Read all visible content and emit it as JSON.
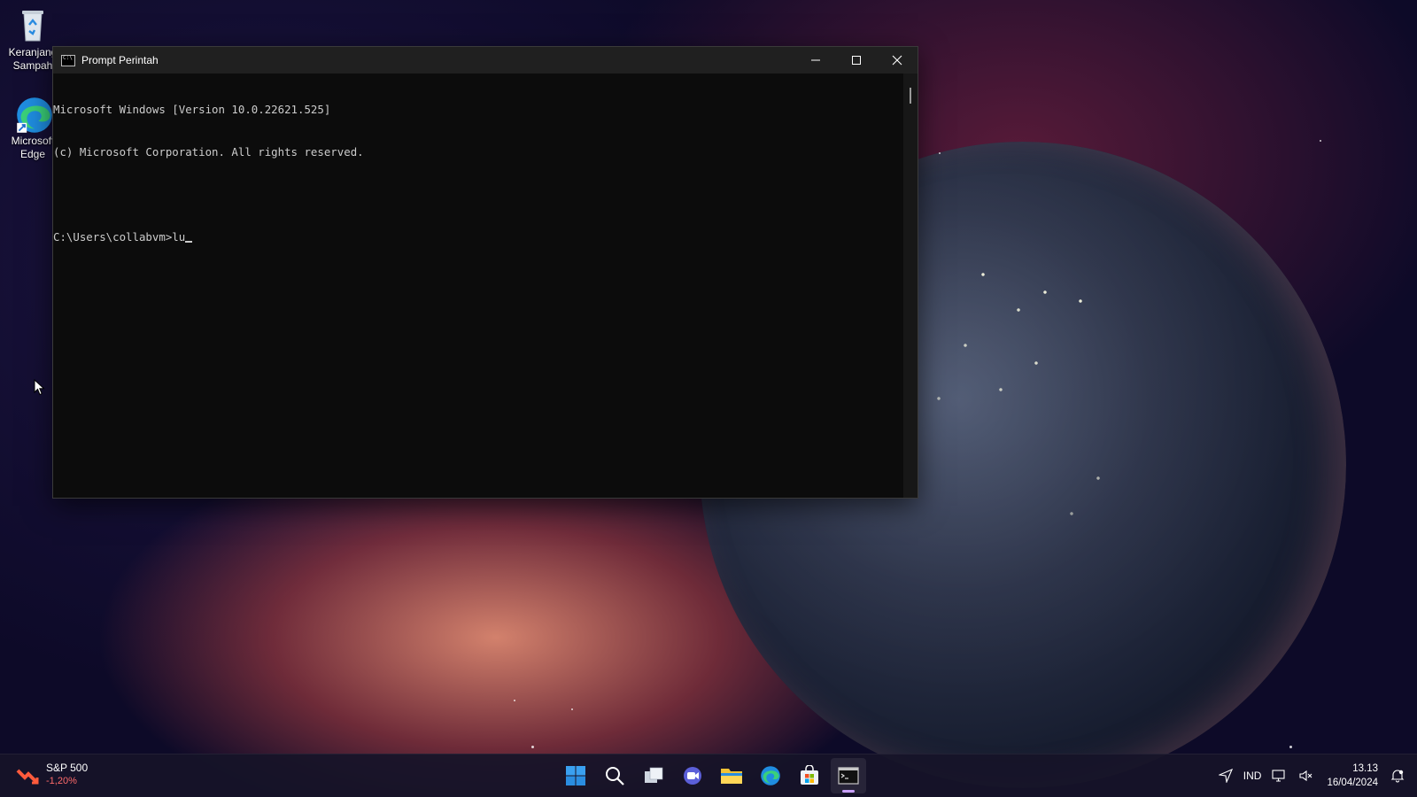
{
  "desktop": {
    "icons": [
      {
        "label_line1": "Keranjang",
        "label_line2": "Sampah"
      },
      {
        "label_line1": "Microsoft",
        "label_line2": "Edge"
      }
    ]
  },
  "window": {
    "title": "Prompt Perintah",
    "console_lines": [
      "Microsoft Windows [Version 10.0.22621.525]",
      "(c) Microsoft Corporation. All rights reserved.",
      "",
      "C:\\Users\\collabvm>lu"
    ]
  },
  "taskbar": {
    "widget": {
      "name": "S&P 500",
      "value": "-1,20%"
    },
    "apps": [
      "start-icon",
      "search-icon",
      "task-view-icon",
      "chat-icon",
      "file-explorer-icon",
      "edge-icon",
      "store-icon",
      "terminal-icon"
    ],
    "tray": {
      "language": "IND",
      "time": "13.13",
      "date": "16/04/2024"
    }
  },
  "colors": {
    "console_bg": "#0c0c0c",
    "console_text": "#cccccc",
    "titlebar": "#202020",
    "widget_negative": "#ff6b6b"
  }
}
